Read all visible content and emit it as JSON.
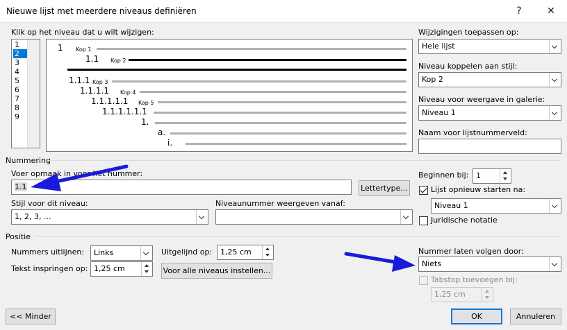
{
  "window": {
    "title": "Nieuwe lijst met meerdere niveaus definiëren",
    "help": "?",
    "close": "✕"
  },
  "levels": {
    "label": "Klik op het niveau dat u wilt wijzigen:",
    "items": [
      "1",
      "2",
      "3",
      "4",
      "5",
      "6",
      "7",
      "8",
      "9"
    ],
    "selected": "2"
  },
  "preview": {
    "rows": [
      {
        "number": "1",
        "style": "Kop 1"
      },
      {
        "number": "1.1",
        "style": "Kop 2"
      },
      {
        "number": "1.1.1",
        "style": "Kop 3"
      },
      {
        "number": "1.1.1.1",
        "style": "Kop 4"
      },
      {
        "number": "1.1.1.1.1",
        "style": "Kop 5"
      },
      {
        "number": "1.1.1.1.1.1",
        "style": ""
      },
      {
        "number": "1.",
        "style": ""
      },
      {
        "number": "a.",
        "style": ""
      },
      {
        "number": "i.",
        "style": ""
      }
    ]
  },
  "right": {
    "apply_label": "Wijzigingen toepassen op:",
    "apply_value": "Hele lijst",
    "link_label": "Niveau koppelen aan stijl:",
    "link_value": "Kop 2",
    "gallery_label": "Niveau voor weergave in galerie:",
    "gallery_value": "Niveau 1",
    "fieldname_label": "Naam voor lijstnummerveld:",
    "fieldname_value": ""
  },
  "numbering": {
    "group_title": "Nummering",
    "format_label": "Voer opmaak in voor het nummer:",
    "format_value": "1.1",
    "font_button": "Lettertype...",
    "style_label": "Stijl voor dit niveau:",
    "style_value": "1, 2, 3, ...",
    "include_label": "Niveaunummer weergeven vanaf:",
    "include_value": "",
    "start_label": "Beginnen bij:",
    "start_value": "1",
    "restart_label": "Lijst opnieuw starten na:",
    "restart_checked": true,
    "restart_value": "Niveau 1",
    "legal_label": "Juridische notatie",
    "legal_checked": false
  },
  "position": {
    "group_title": "Positie",
    "align_label": "Nummers uitlijnen:",
    "align_value": "Links",
    "aligned_at_label": "Uitgelijnd op:",
    "aligned_at_value": "1,25 cm",
    "indent_label": "Tekst inspringen op:",
    "indent_value": "1,25 cm",
    "all_levels_button": "Voor alle niveaus instellen...",
    "follow_label": "Nummer laten volgen door:",
    "follow_value": "Niets",
    "tabstop_label": "Tabstop toevoegen bij:",
    "tabstop_value": "1,25 cm"
  },
  "footer": {
    "less_button": "<< Minder",
    "ok_button": "OK",
    "cancel_button": "Annuleren"
  },
  "colors": {
    "accent": "#0078d7",
    "arrow": "#1a1adc"
  }
}
